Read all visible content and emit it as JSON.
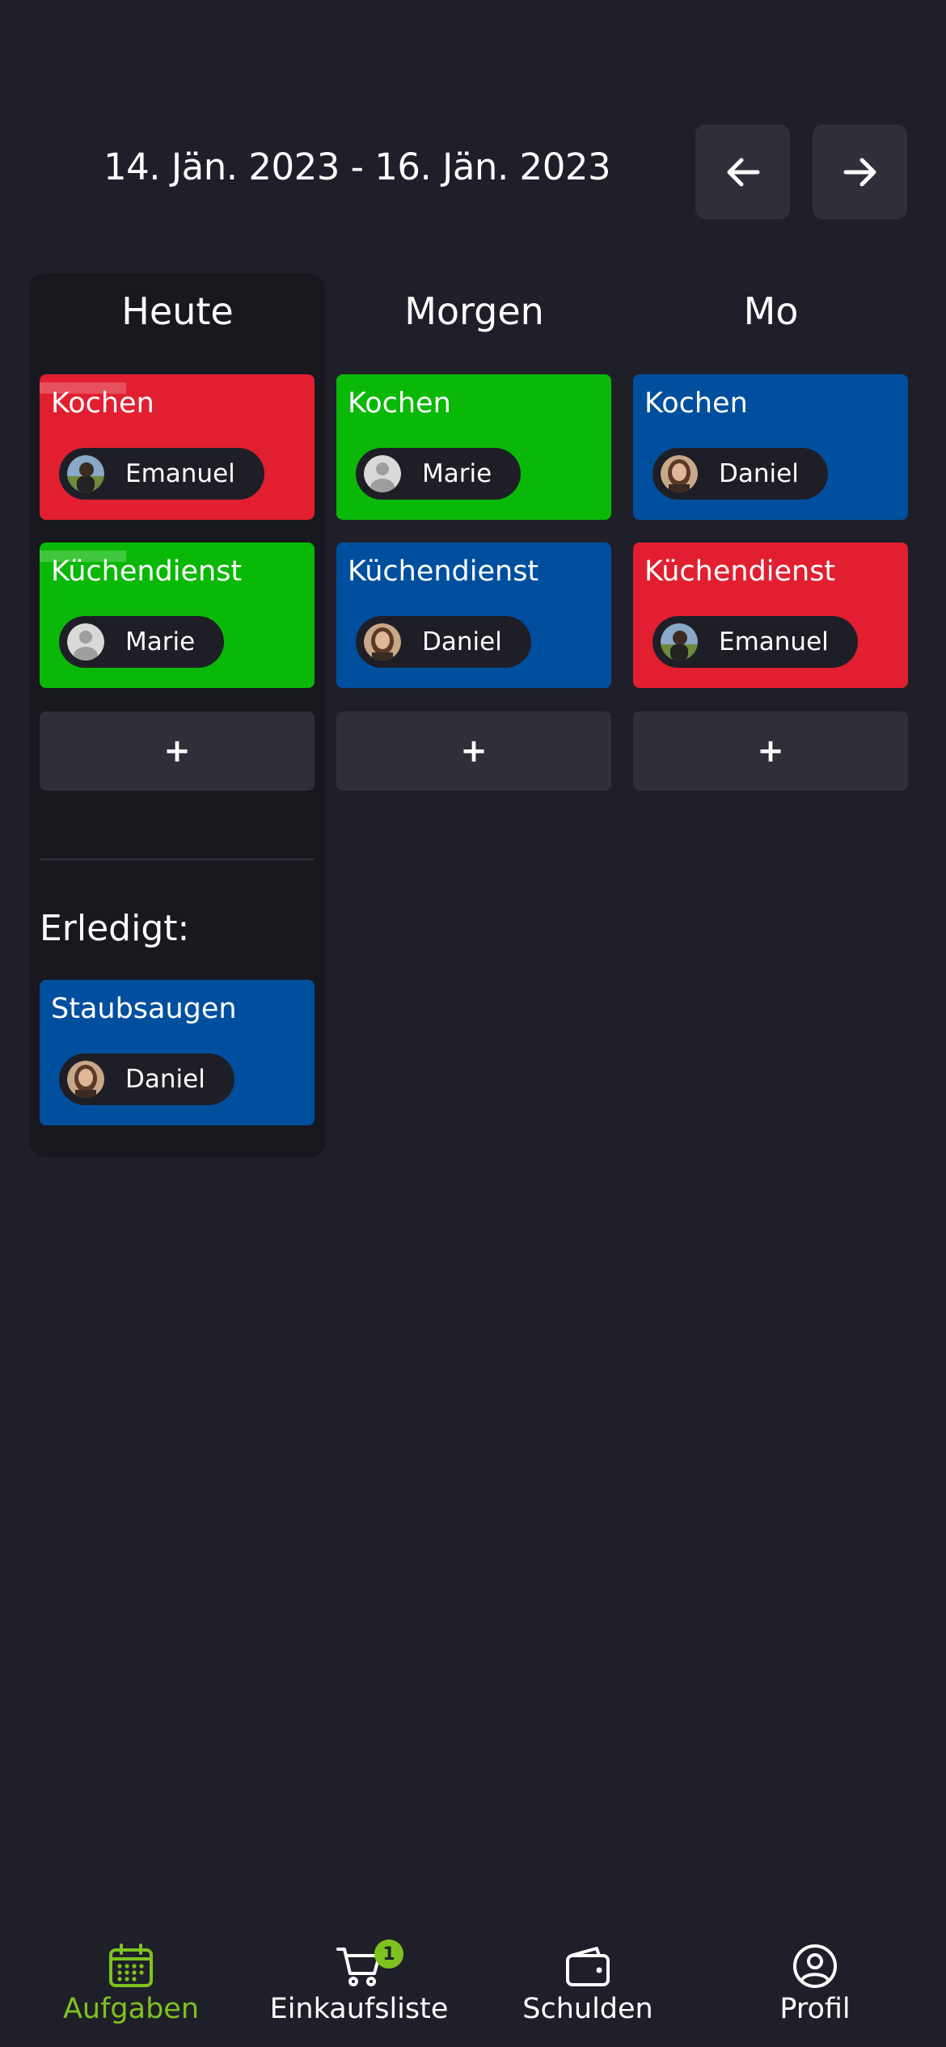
{
  "header": {
    "date_range": "14. Jän. 2023 - 16. Jän. 2023",
    "prev_icon": "arrow-left-icon",
    "next_icon": "arrow-right-icon"
  },
  "columns": [
    {
      "title": "Heute",
      "tasks": [
        {
          "name": "Kochen",
          "color": "#e11f30",
          "assignee": "Emanuel"
        },
        {
          "name": "Küchendienst",
          "color": "#0ab807",
          "assignee": "Marie"
        }
      ],
      "add_label": "+",
      "done_label": "Erledigt:",
      "done_tasks": [
        {
          "name": "Staubsaugen",
          "color": "#004f9e",
          "assignee": "Daniel"
        }
      ]
    },
    {
      "title": "Morgen",
      "tasks": [
        {
          "name": "Kochen",
          "color": "#0ab807",
          "assignee": "Marie"
        },
        {
          "name": "Küchendienst",
          "color": "#004f9e",
          "assignee": "Daniel"
        }
      ],
      "add_label": "+"
    },
    {
      "title": "Mo",
      "tasks": [
        {
          "name": "Kochen",
          "color": "#004f9e",
          "assignee": "Daniel"
        },
        {
          "name": "Küchendienst",
          "color": "#e11f30",
          "assignee": "Emanuel"
        }
      ],
      "add_label": "+"
    }
  ],
  "bottom_nav": [
    {
      "label": "Aufgaben",
      "icon": "calendar-icon",
      "active": true
    },
    {
      "label": "Einkaufsliste",
      "icon": "cart-icon",
      "badge": "1"
    },
    {
      "label": "Schulden",
      "icon": "wallet-icon"
    },
    {
      "label": "Profil",
      "icon": "user-circle-icon"
    }
  ],
  "colors": {
    "background": "#1f1f29",
    "accent": "#7ec21f",
    "red": "#e11f30",
    "green": "#0ab807",
    "blue": "#004f9e"
  }
}
